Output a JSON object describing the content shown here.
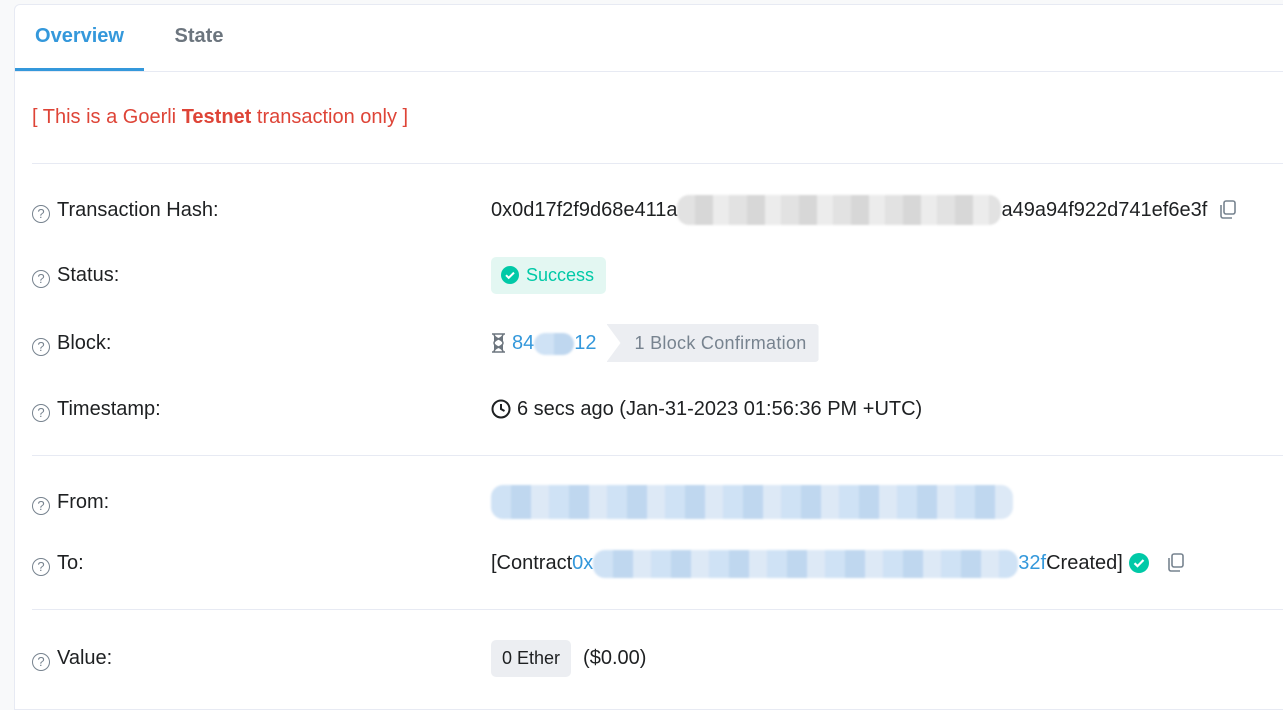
{
  "tabs": [
    {
      "label": "Overview",
      "active": true
    },
    {
      "label": "State",
      "active": false
    }
  ],
  "notice": {
    "prefix": "[ This is a Goerli ",
    "bold": "Testnet",
    "suffix": " transaction only ]"
  },
  "rows": {
    "hash": {
      "label": "Transaction Hash:",
      "start": "0x0d17f2f9d68e411a",
      "end": "a49a94f922d741ef6e3f"
    },
    "status": {
      "label": "Status:",
      "value": "Success"
    },
    "block": {
      "label": "Block:",
      "number_start": "84",
      "number_end": "12",
      "confirmation": "1 Block Confirmation"
    },
    "timestamp": {
      "label": "Timestamp:",
      "value": "6 secs ago (Jan-31-2023 01:56:36 PM +UTC)"
    },
    "from": {
      "label": "From:"
    },
    "to": {
      "label": "To:",
      "prefix": "[Contract ",
      "addr_start": "0x",
      "addr_end": "32f",
      "suffix": " Created]"
    },
    "value": {
      "label": "Value:",
      "amount": "0 Ether",
      "usd": "($0.00)"
    }
  },
  "colors": {
    "accent": "#3498db",
    "success": "#00c9a7",
    "danger": "#de4437"
  },
  "icons": [
    "question-icon",
    "copy-icon",
    "check-circle-icon",
    "hourglass-icon",
    "clock-icon"
  ]
}
